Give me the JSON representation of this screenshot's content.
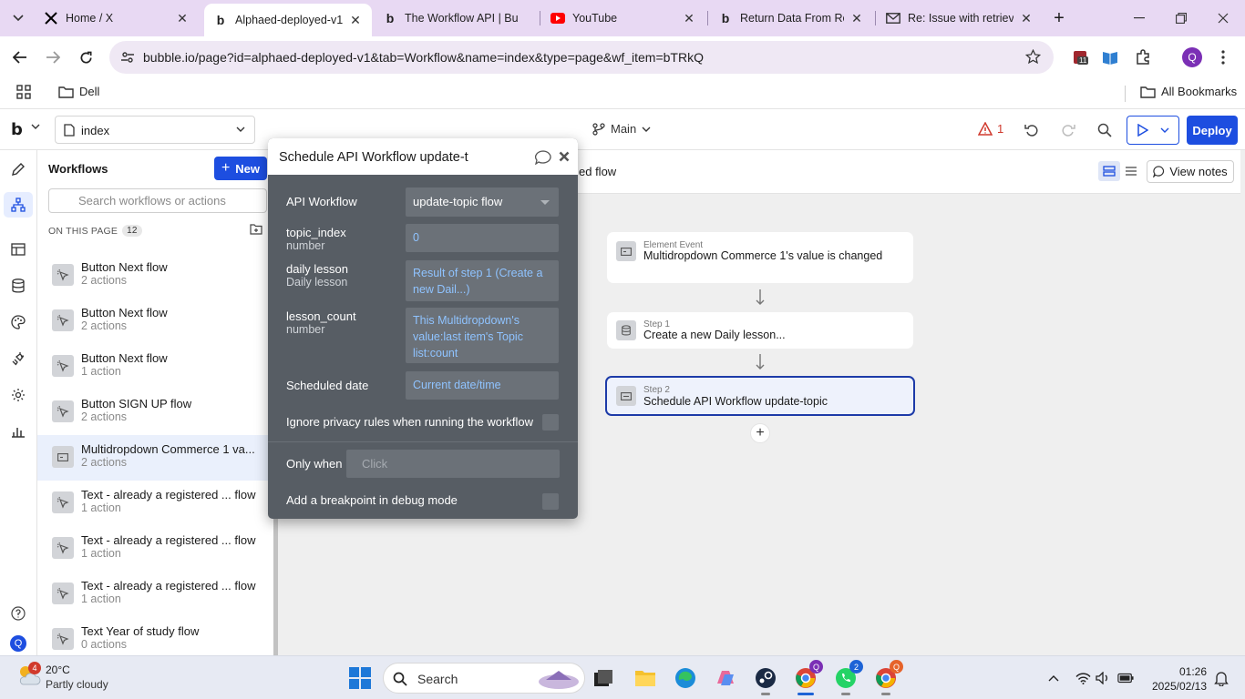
{
  "browser": {
    "tabs": [
      {
        "title": "Home / X",
        "favicon": "x-logo-icon"
      },
      {
        "title": "Alphaed-deployed-v1",
        "favicon": "bubble-logo-icon",
        "active": true
      },
      {
        "title": "The Workflow API | Bu",
        "favicon": "bubble-logo-icon"
      },
      {
        "title": "YouTube",
        "favicon": "youtube-icon"
      },
      {
        "title": "Return Data From Re",
        "favicon": "bubble-logo-icon"
      },
      {
        "title": "Re: Issue with retrievi",
        "favicon": "mail-icon"
      }
    ],
    "url": "bubble.io/page?id=alphaed-deployed-v1&tab=Workflow&name=index&type=page&wf_item=bTRkQ",
    "extension_badge": "11",
    "profile_initial": "Q",
    "bookmarks": {
      "folder": "Dell",
      "all": "All Bookmarks"
    }
  },
  "header": {
    "logo": "b",
    "page_name": "index",
    "branch": "Main",
    "issue_count": "1",
    "deploy_label": "Deploy"
  },
  "workflows_panel": {
    "title": "Workflows",
    "new_label": "New",
    "search_placeholder": "Search workflows or actions",
    "section_label": "ON THIS PAGE",
    "count": "12",
    "items": [
      {
        "name": "Button Next flow",
        "actions": "2 actions"
      },
      {
        "name": "Button Next flow",
        "actions": "2 actions"
      },
      {
        "name": "Button Next flow",
        "actions": "1 action"
      },
      {
        "name": "Button SIGN UP flow",
        "actions": "2 actions"
      },
      {
        "name": "Multidropdown Commerce 1 va...",
        "actions": "2 actions",
        "selected": true
      },
      {
        "name": "Text - already a registered ... flow",
        "actions": "1 action"
      },
      {
        "name": "Text - already a registered ... flow",
        "actions": "1 action"
      },
      {
        "name": "Text - already a registered ... flow",
        "actions": "1 action"
      },
      {
        "name": "Text Year of study flow",
        "actions": "0 actions"
      }
    ]
  },
  "canvas": {
    "flow_title_fragment": "ed flow",
    "view_notes": "View notes",
    "event": {
      "label": "Element Event",
      "text": "Multidropdown Commerce 1's value is changed"
    },
    "step1": {
      "label": "Step 1",
      "text": "Create a new Daily lesson..."
    },
    "step2": {
      "label": "Step 2",
      "text": "Schedule API Workflow update-topic"
    }
  },
  "editor": {
    "title": "Schedule API Workflow update-t",
    "api_workflow_label": "API Workflow",
    "api_workflow_value": "update-topic flow",
    "fields": [
      {
        "label": "topic_index",
        "type": "number",
        "value": "0"
      },
      {
        "label": "daily lesson",
        "type": "Daily lesson",
        "value": "Result of step 1 (Create a new Dail...)"
      },
      {
        "label": "lesson_count",
        "type": "number",
        "value": "This Multidropdown's value:last item's Topic list:count"
      }
    ],
    "scheduled_date_label": "Scheduled date",
    "scheduled_date_value": "Current date/time",
    "ignore_privacy_label": "Ignore privacy rules when running the workflow",
    "only_when_label": "Only when",
    "only_when_placeholder": "Click",
    "breakpoint_label": "Add a breakpoint in debug mode"
  },
  "taskbar": {
    "weather_badge": "4",
    "temperature": "20°C",
    "condition": "Partly cloudy",
    "search_label": "Search",
    "chrome_badge": "Q",
    "whatsapp_badge": "2",
    "chrome2_badge": "Q",
    "time": "01:26",
    "date": "2025/02/13"
  },
  "colors": {
    "accent": "#1d4ee0",
    "tabstrip": "#e8d9f3",
    "editor_bg": "#575d64",
    "dynamic_text": "#8fc3ff",
    "warning": "#d03a2e"
  }
}
